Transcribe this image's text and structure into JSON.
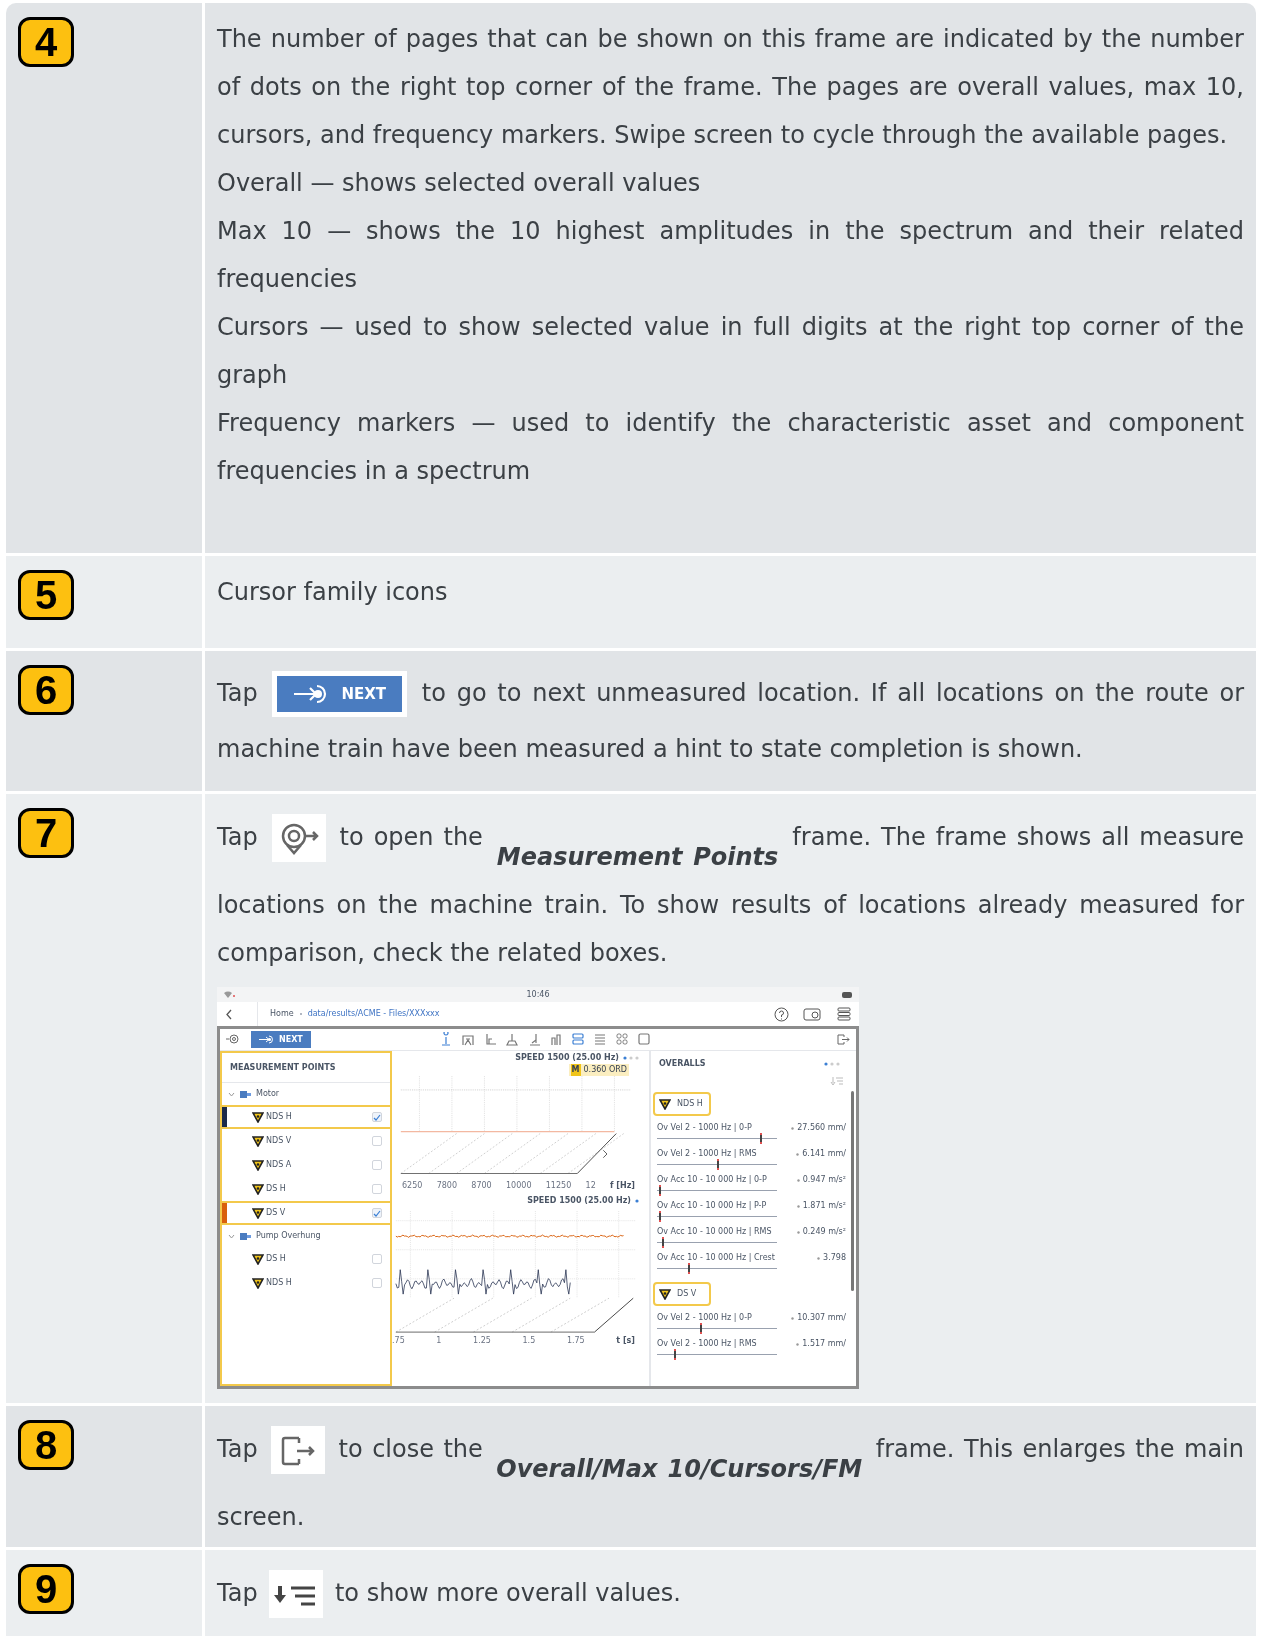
{
  "rows": [
    {
      "number": "4",
      "paragraphs": [
        [
          {
            "kind": "text",
            "text": "The number of pages that can be shown on this frame are indicated by the number of dots on the right top corner of the frame. The pages are overall values, max 10, cursors, and frequency markers. Swipe screen to cycle through the available pages."
          }
        ],
        [
          {
            "kind": "text",
            "text": "Overall — shows selected overall values"
          }
        ],
        [
          {
            "kind": "text",
            "text": "Max 10 — shows the 10 highest amplitudes in the spectrum and their related frequencies"
          }
        ],
        [
          {
            "kind": "text",
            "text": "Cursors — used to show selected value in full digits at the right top corner of the graph"
          }
        ],
        [
          {
            "kind": "text",
            "text": "Frequency markers — used to identify the characteristic asset and component frequencies in a spectrum"
          }
        ]
      ]
    },
    {
      "number": "5",
      "paragraphs": [
        [
          {
            "kind": "text",
            "text": "Cursor family icons"
          }
        ]
      ]
    },
    {
      "number": "6",
      "paragraphs": [
        [
          {
            "kind": "text",
            "text": "Tap"
          },
          {
            "kind": "next_button",
            "label": "NEXT"
          },
          {
            "kind": "text",
            "text": "to go to next unmeasured location. If all locations on the route or machine train have been measured a hint to state completion is shown."
          }
        ]
      ]
    },
    {
      "number": "7",
      "paragraphs": [
        [
          {
            "kind": "text",
            "text": "Tap"
          },
          {
            "kind": "points_icon"
          },
          {
            "kind": "text",
            "text": "to open the"
          },
          {
            "kind": "term",
            "text": "Measurement Points"
          },
          {
            "kind": "text",
            "text": "frame. The frame shows all measure locations on the machine train. To show results of locations already measured for comparison, check the related boxes."
          }
        ]
      ],
      "figure": {
        "time": "10:46",
        "breadcrumb": {
          "home": "Home",
          "path": "data/results/ACME - Files/XXXxxx"
        },
        "next_label": "NEXT",
        "cursor_tools": [
          {
            "selected": true
          },
          {
            "selected": false
          },
          {
            "selected": false
          },
          {
            "selected": false
          },
          {
            "selected": false
          },
          {
            "selected": false
          }
        ],
        "layouts": [
          {
            "selected": true
          },
          {
            "selected": false
          },
          {
            "selected": false
          },
          {
            "selected": false
          }
        ],
        "points_title": "MEASUREMENT POINTS",
        "machines": [
          {
            "label": "Motor",
            "expanded": true,
            "children": [
              {
                "label": "NDS H",
                "checked": true,
                "color": "#1c2a4a"
              },
              {
                "label": "NDS V",
                "checked": false
              },
              {
                "label": "NDS A",
                "checked": false
              },
              {
                "label": "DS H",
                "checked": false
              },
              {
                "label": "DS V",
                "checked": true,
                "color": "#d9600c"
              }
            ]
          },
          {
            "label": "Pump Overhung",
            "expanded": true,
            "children": [
              {
                "label": "DS H",
                "checked": false
              },
              {
                "label": "NDS H",
                "checked": false
              }
            ]
          }
        ],
        "spectrum": {
          "speed": "SPEED 1500 (25.00 Hz)",
          "marker": "M",
          "marker_value": "0.360 ORD",
          "ticks": [
            "6250",
            "7800",
            "8700",
            "10000",
            "11250",
            "12"
          ],
          "axis": "f [Hz]"
        },
        "waveform": {
          "speed": "SPEED 1500 (25.00 Hz)",
          "ticks": [
            ".75",
            "1",
            "1.25",
            "1.5",
            "1.75"
          ],
          "axis": "t [s]"
        },
        "overalls_title": "OVERALLS",
        "groups": [
          {
            "label": "NDS H",
            "items": [
              {
                "label": "Ov Vel 2 - 1000 Hz | 0-P",
                "reading": "27.560 mm/",
                "level": 0.86
              },
              {
                "label": "Ov Vel 2 - 1000 Hz | RMS",
                "reading": "6.141 mm/",
                "level": 0.5
              },
              {
                "label": "Ov Acc 10 - 10 000 Hz | 0-P",
                "reading": "0.947 m/s²",
                "level": 0.02
              },
              {
                "label": "Ov Acc 10 - 10 000 Hz | P-P",
                "reading": "1.871 m/s²",
                "level": 0.02
              },
              {
                "label": "Ov Acc 10 - 10 000 Hz | RMS",
                "reading": "0.249 m/s²",
                "level": 0.04
              },
              {
                "label": "Ov Acc 10 - 10 000 Hz | Crest",
                "reading": "3.798",
                "level": 0.26
              }
            ]
          },
          {
            "label": "DS V",
            "items": [
              {
                "label": "Ov Vel 2 - 1000 Hz | 0-P",
                "reading": "10.307 mm/",
                "level": 0.36
              },
              {
                "label": "Ov Vel 2 - 1000 Hz | RMS",
                "reading": "1.517 mm/",
                "level": 0.14
              }
            ]
          }
        ]
      }
    },
    {
      "number": "8",
      "paragraphs": [
        [
          {
            "kind": "text",
            "text": "Tap"
          },
          {
            "kind": "close_icon"
          },
          {
            "kind": "text",
            "text": "to close the"
          },
          {
            "kind": "term",
            "text": "Overall/Max 10/Cursors/FM"
          },
          {
            "kind": "text",
            "text": "frame. This enlarges the main screen."
          }
        ]
      ]
    },
    {
      "number": "9",
      "paragraphs": [
        [
          {
            "kind": "text",
            "text": "Tap"
          },
          {
            "kind": "more_icon"
          },
          {
            "kind": "text",
            "text": "to show more overall values."
          }
        ]
      ]
    }
  ]
}
